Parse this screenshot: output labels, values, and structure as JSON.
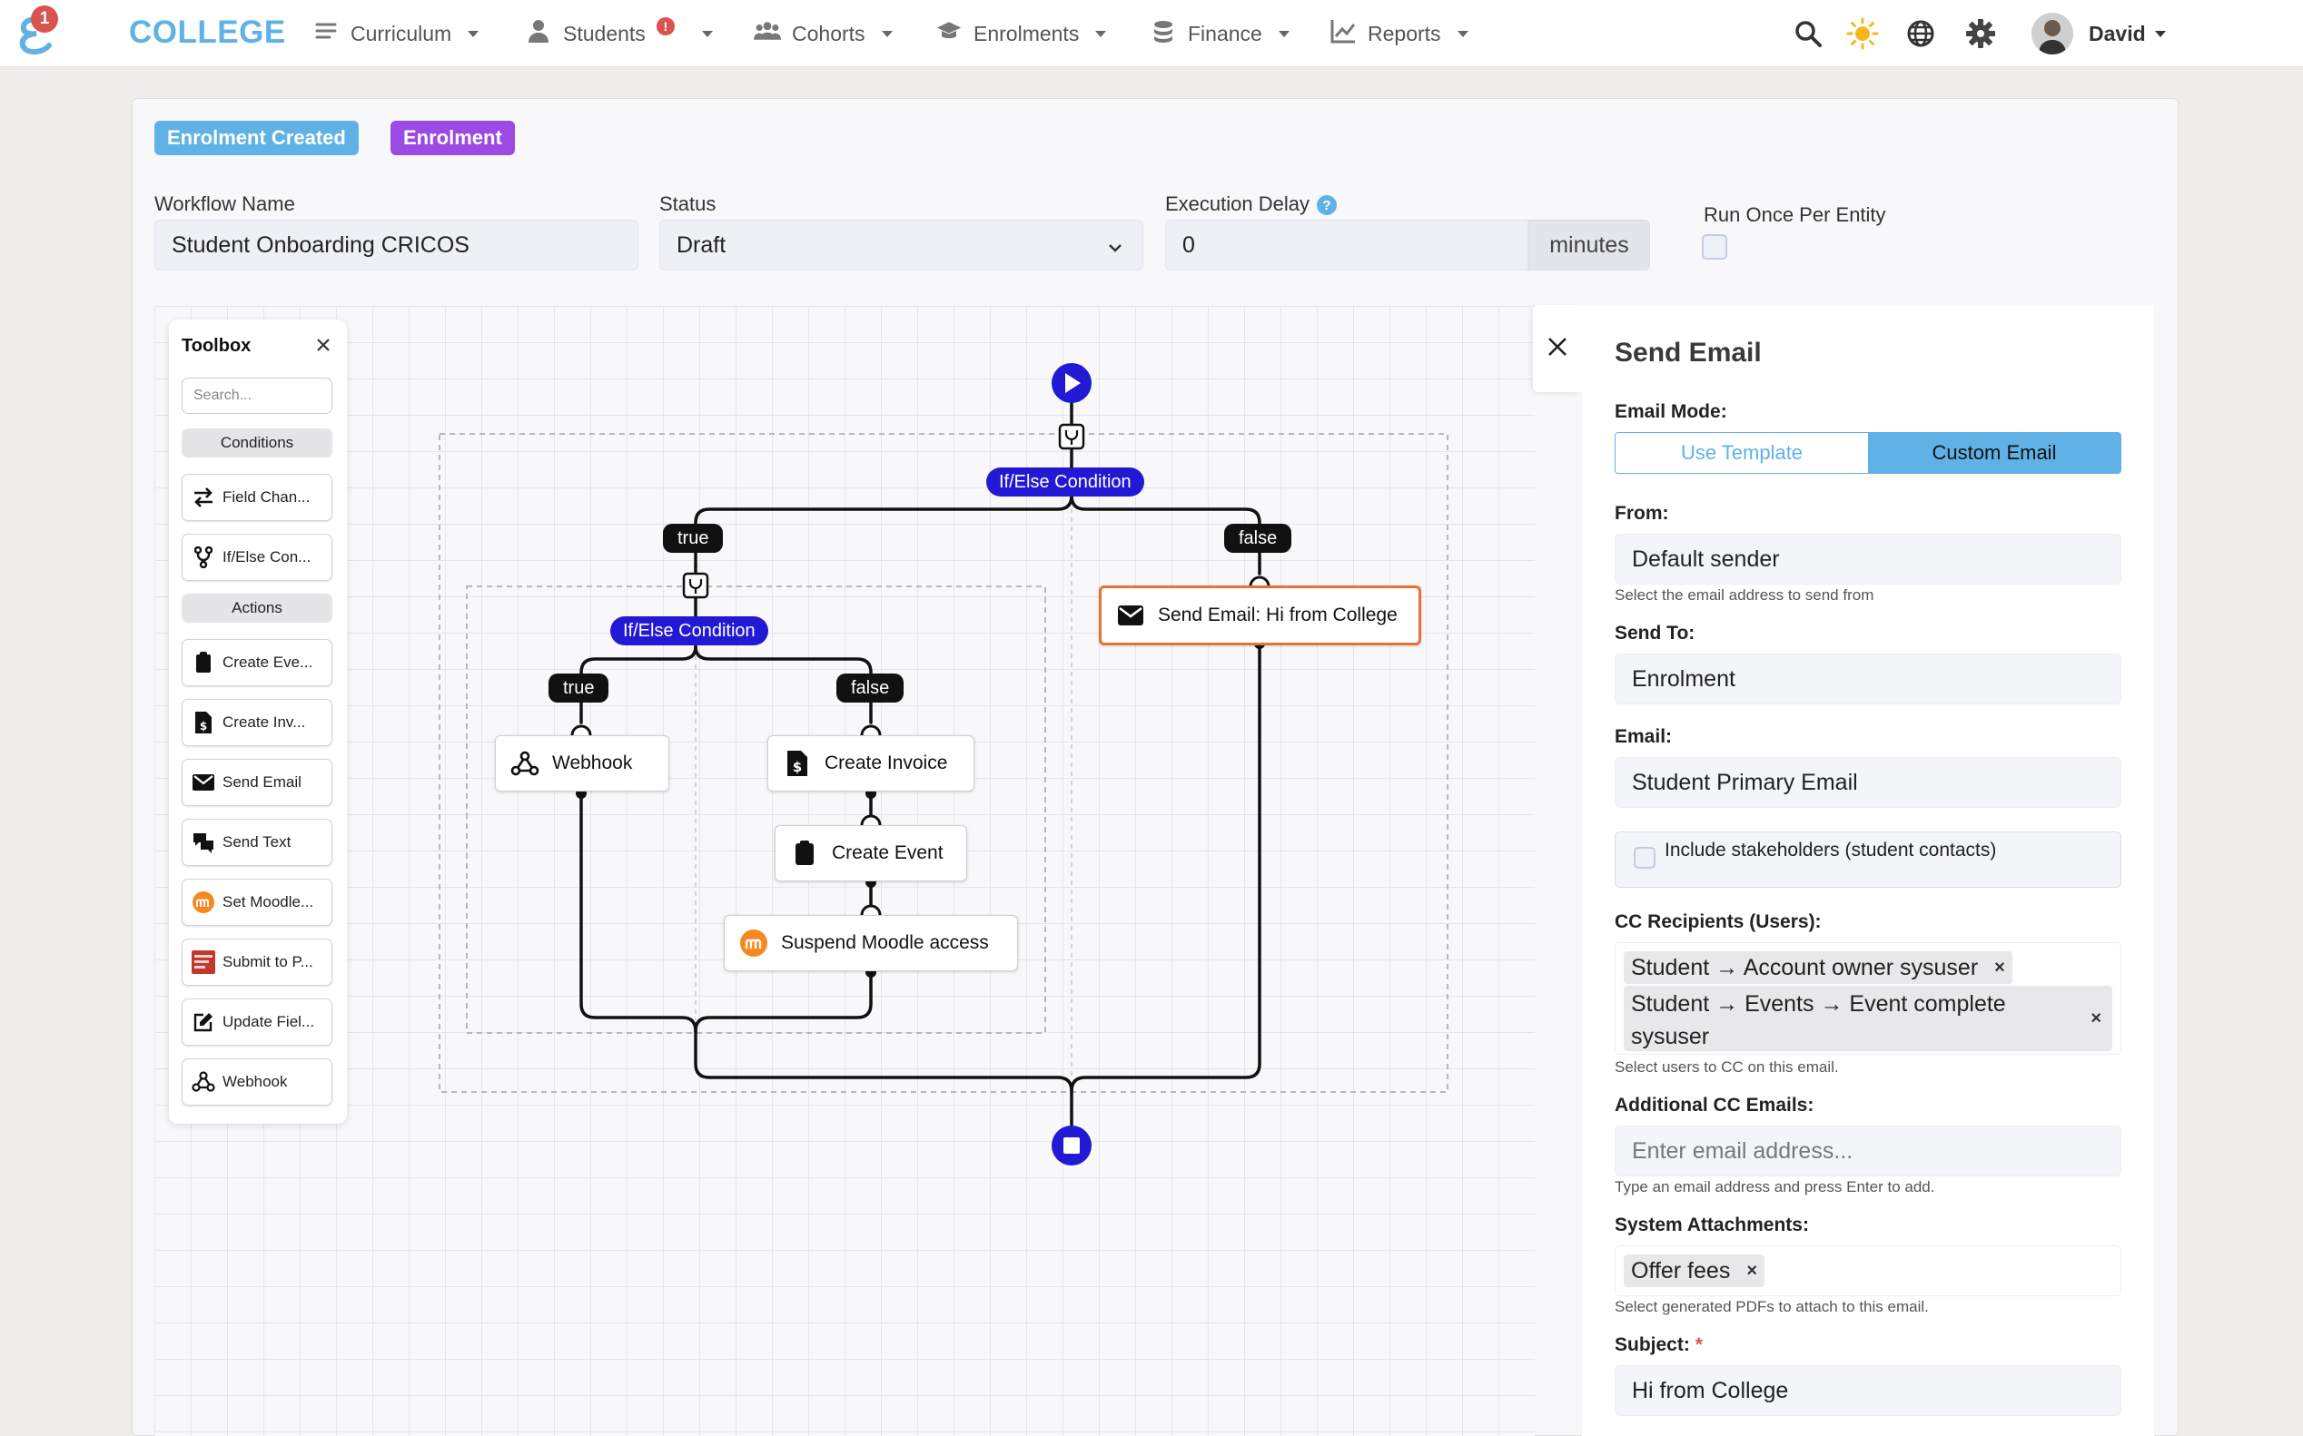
{
  "app": {
    "brand": "COLLEGE",
    "logo_badge": "1",
    "nav": [
      {
        "label": "Curriculum",
        "icon": "menu-lines-icon"
      },
      {
        "label": "Students",
        "icon": "user-icon",
        "alert": "!"
      },
      {
        "label": "Cohorts",
        "icon": "group-icon"
      },
      {
        "label": "Enrolments",
        "icon": "graduation-cap-icon"
      },
      {
        "label": "Finance",
        "icon": "coins-icon"
      },
      {
        "label": "Reports",
        "icon": "line-chart-icon"
      }
    ],
    "user": "David"
  },
  "workflow": {
    "tags": [
      "Enrolment Created",
      "Enrolment"
    ],
    "name_label": "Workflow Name",
    "name_value": "Student Onboarding CRICOS",
    "status_label": "Status",
    "status_value": "Draft",
    "delay_label": "Execution Delay",
    "delay_help": "?",
    "delay_value": "0",
    "delay_unit": "minutes",
    "run_once_label": "Run Once Per Entity",
    "run_once_checked": false
  },
  "toolbox": {
    "title": "Toolbox",
    "search_placeholder": "Search...",
    "sections": [
      {
        "label": "Conditions",
        "items": [
          "Field Chan...",
          "If/Else Con..."
        ]
      },
      {
        "label": "Actions",
        "items": [
          "Create Eve...",
          "Create Inv...",
          "Send Email",
          "Send Text",
          "Set Moodle...",
          "Submit to P...",
          "Update Fiel...",
          "Webhook"
        ]
      }
    ]
  },
  "flow": {
    "cond_outer": "If/Else Condition",
    "cond_inner": "If/Else Condition",
    "branch_true": "true",
    "branch_false": "false",
    "nodes": {
      "send_email": "Send Email: Hi from College",
      "webhook": "Webhook",
      "create_invoice": "Create Invoice",
      "create_event": "Create Event",
      "suspend_moodle": "Suspend Moodle access"
    },
    "colors": {
      "accent": "#2119d4",
      "selected": "#e8713a",
      "line": "#111111"
    }
  },
  "panel": {
    "title": "Send Email",
    "email_mode_label": "Email Mode:",
    "mode_options": [
      "Use Template",
      "Custom Email"
    ],
    "mode_selected": "Custom Email",
    "from_label": "From:",
    "from_value": "Default sender",
    "from_help": "Select the email address to send from",
    "send_to_label": "Send To:",
    "send_to_value": "Enrolment",
    "email_label": "Email:",
    "email_value": "Student Primary Email",
    "stakeholders_label": "Include stakeholders (student contacts)",
    "cc_label": "CC Recipients (Users):",
    "cc_chips": [
      "Student → Account owner sysuser",
      "Student → Events → Event complete sysuser"
    ],
    "cc_help": "Select users to CC on this email.",
    "add_cc_label": "Additional CC Emails:",
    "add_cc_placeholder": "Enter email address...",
    "add_cc_help": "Type an email address and press Enter to add.",
    "attach_label": "System Attachments:",
    "attach_chips": [
      "Offer fees"
    ],
    "attach_help": "Select generated PDFs to attach to this email.",
    "subject_label": "Subject:",
    "subject_required": "*",
    "subject_value": "Hi from College"
  }
}
